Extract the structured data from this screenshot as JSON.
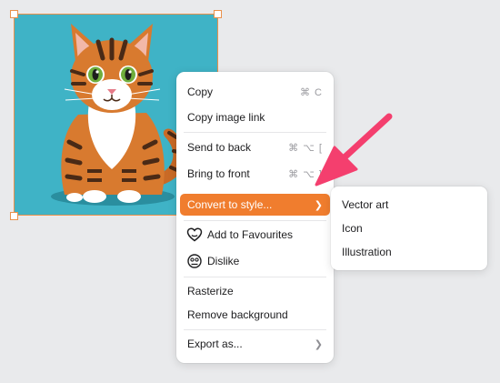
{
  "image": {
    "subject": "cartoon-tabby-cat-illustration",
    "background_color": "#3fb3c6",
    "selection_color": "#e9914b"
  },
  "context_menu": {
    "items": [
      {
        "label": "Copy",
        "shortcut": "⌘ C"
      },
      {
        "label": "Copy image link",
        "shortcut": ""
      },
      {
        "label": "Send to back",
        "shortcut": "⌘ ⌥ ["
      },
      {
        "label": "Bring to front",
        "shortcut": "⌘ ⌥ ]"
      },
      {
        "label": "Convert to style...",
        "shortcut": "",
        "submenu": true,
        "highlighted": true
      },
      {
        "label": "Add to Favourites",
        "icon": "heart-outline-icon"
      },
      {
        "label": "Dislike",
        "icon": "dislike-face-icon"
      },
      {
        "label": "Rasterize",
        "shortcut": ""
      },
      {
        "label": "Remove background",
        "shortcut": ""
      },
      {
        "label": "Export as...",
        "shortcut": "",
        "submenu": true
      }
    ],
    "highlight_color": "#f07d2e"
  },
  "submenu": {
    "items": [
      {
        "label": "Vector art"
      },
      {
        "label": "Icon"
      },
      {
        "label": "Illustration"
      }
    ]
  },
  "annotation": {
    "arrow_color": "#f43f6e"
  }
}
